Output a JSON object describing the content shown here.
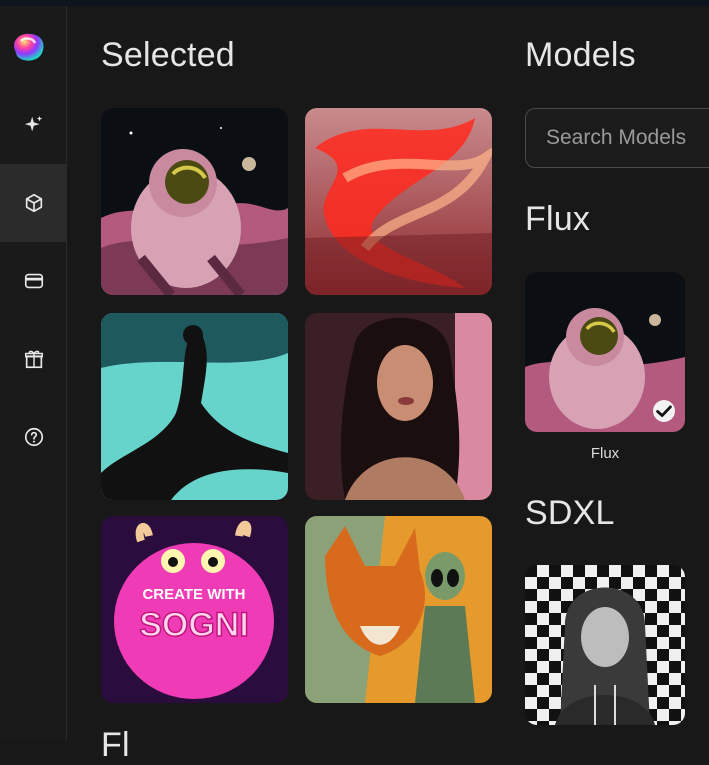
{
  "sections": {
    "selected_title": "Selected",
    "models_title": "Models",
    "next_title_partial": "Fl"
  },
  "search": {
    "placeholder": "Search Models"
  },
  "sidebar": {
    "items": [
      {
        "icon": "sparkle-icon",
        "active": false
      },
      {
        "icon": "cube-icon",
        "active": true
      },
      {
        "icon": "wallet-icon",
        "active": false
      },
      {
        "icon": "gift-icon",
        "active": false
      },
      {
        "icon": "help-icon",
        "active": false
      }
    ]
  },
  "selected_images": [
    {
      "subject": "astronaut"
    },
    {
      "subject": "red smoke"
    },
    {
      "subject": "underwater dancer"
    },
    {
      "subject": "portrait woman"
    },
    {
      "subject": "pink monster",
      "caption_lines": [
        "CREATE WITH",
        "SOGNI"
      ]
    },
    {
      "subject": "fox and alien"
    }
  ],
  "model_groups": [
    {
      "title": "Flux",
      "models": [
        {
          "label": "Flux",
          "selected": true
        }
      ]
    },
    {
      "title": "SDXL",
      "models": [
        {
          "label": "",
          "selected": false
        }
      ]
    }
  ],
  "colors": {
    "background": "#181818",
    "sidebar": "#1a1a1a",
    "active_nav": "#2b2b2b",
    "text": "#e6e6e6"
  }
}
